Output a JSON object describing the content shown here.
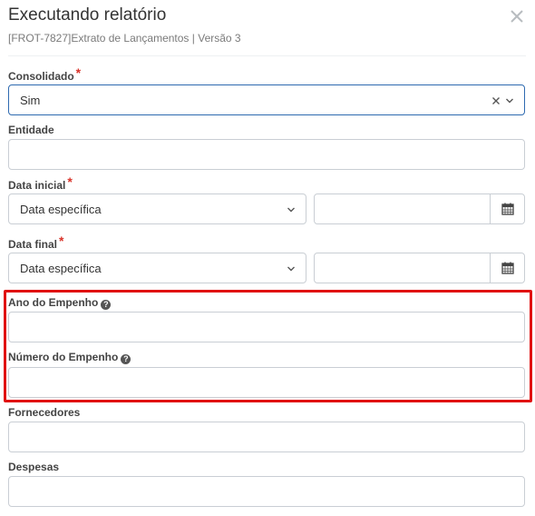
{
  "dialog": {
    "title": "Executando relatório",
    "subtitle": "[FROT-7827]Extrato de Lançamentos | Versão 3"
  },
  "fields": {
    "consolidado": {
      "label": "Consolidado",
      "required": "*",
      "value": "Sim"
    },
    "entidade": {
      "label": "Entidade",
      "value": ""
    },
    "data_inicial": {
      "label": "Data inicial",
      "required": "*",
      "select_value": "Data específica",
      "date_value": ""
    },
    "data_final": {
      "label": "Data final",
      "required": "*",
      "select_value": "Data específica",
      "date_value": ""
    },
    "ano_empenho": {
      "label": "Ano do Empenho",
      "value": ""
    },
    "numero_empenho": {
      "label": "Número do Empenho",
      "value": ""
    },
    "fornecedores": {
      "label": "Fornecedores",
      "value": ""
    },
    "despesas": {
      "label": "Despesas",
      "value": ""
    }
  },
  "icons": {
    "close": "close-icon",
    "clear": "clear-icon",
    "chevron": "chevron-down-icon",
    "calendar": "calendar-icon",
    "help": "question-circle-icon"
  },
  "colors": {
    "required": "#d9342b",
    "focus_border": "#2e6ab0",
    "highlight": "#e01010"
  }
}
